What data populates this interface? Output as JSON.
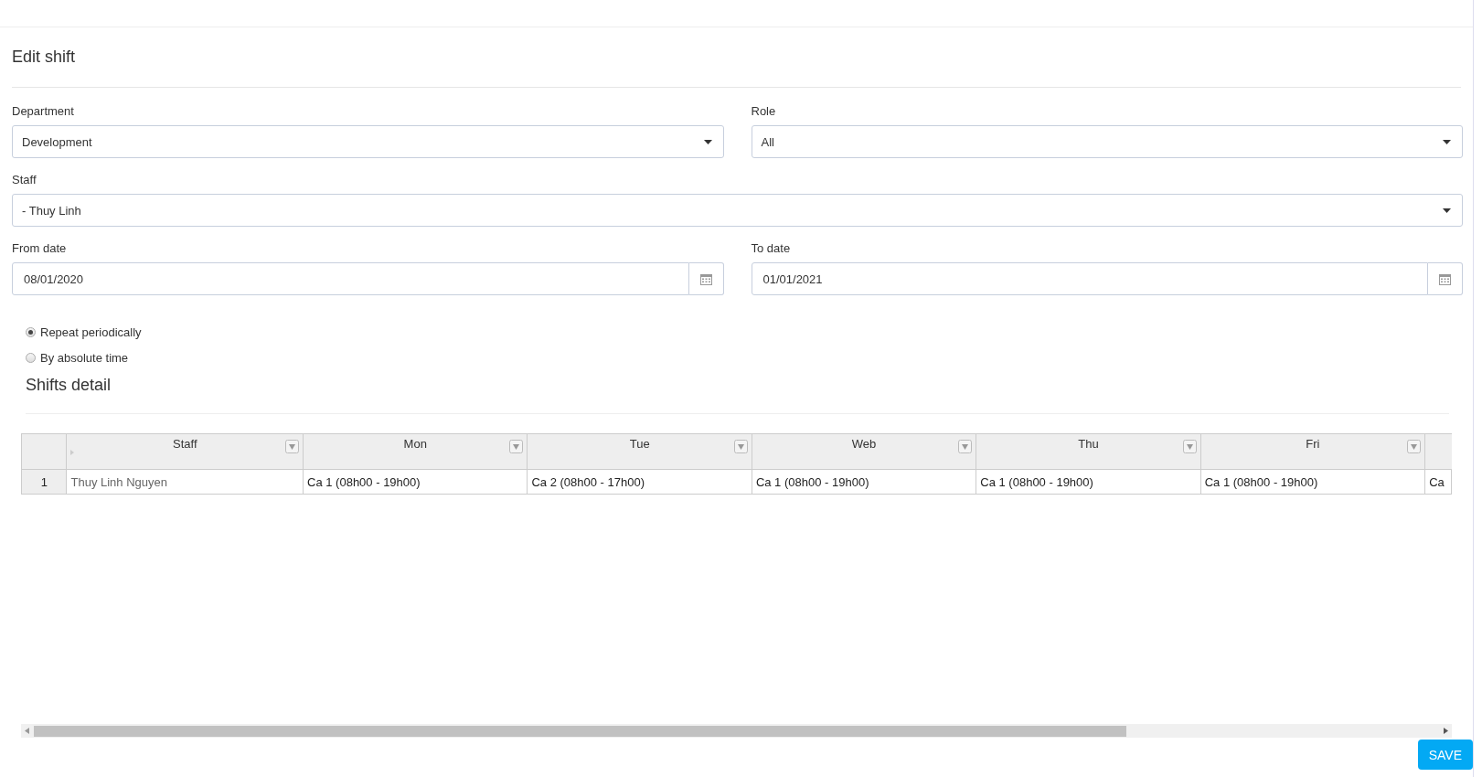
{
  "title": "Edit shift",
  "fields": [
    {
      "label": "Department",
      "value": "Development",
      "kind": "select"
    },
    {
      "label": "Role",
      "value": "All",
      "kind": "select"
    },
    {
      "label": "Staff",
      "value": "- Thuy Linh",
      "kind": "select"
    },
    {
      "label": "From date",
      "value": "08/01/2020",
      "kind": "date"
    },
    {
      "label": "To date",
      "value": "01/01/2021",
      "kind": "date"
    }
  ],
  "options": [
    {
      "label": "Repeat periodically",
      "selected": true
    },
    {
      "label": "By absolute time",
      "selected": false
    }
  ],
  "section_title": "Shifts detail",
  "table": {
    "columns": [
      "",
      "Staff",
      "Mon",
      "Tue",
      "Web",
      "Thu",
      "Fri",
      ""
    ],
    "rows": [
      {
        "cells": [
          "1",
          "Thuy Linh Nguyen",
          "Ca 1 (08h00 - 19h00)",
          "Ca 2 (08h00 - 17h00)",
          "Ca 1 (08h00 - 19h00)",
          "Ca 1 (08h00 - 19h00)",
          "Ca 1 (08h00 - 19h00)",
          "Ca"
        ]
      }
    ]
  },
  "save_button": "SAVE"
}
